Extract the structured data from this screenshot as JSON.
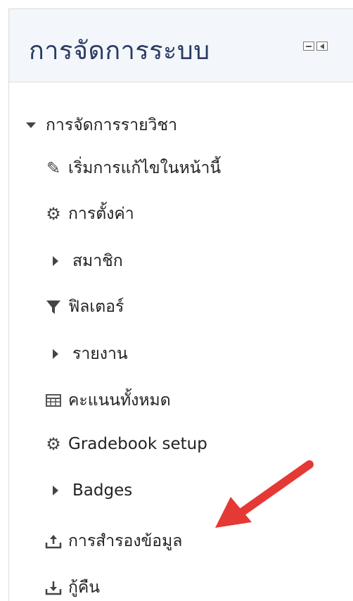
{
  "block": {
    "title": "การจัดการระบบ",
    "root": "การจัดการรายวิชา",
    "items": [
      {
        "label": "เริ่มการแก้ไขในหน้านี้",
        "icon": "pencil-icon"
      },
      {
        "label": "การตั้งค่า",
        "icon": "gear-icon"
      },
      {
        "label": "สมาชิก",
        "icon": "caret-right-icon"
      },
      {
        "label": "ฟิลเตอร์",
        "icon": "filter-icon"
      },
      {
        "label": "รายงาน",
        "icon": "caret-right-icon"
      },
      {
        "label": "คะแนนทั้งหมด",
        "icon": "table-icon"
      },
      {
        "label": "Gradebook setup",
        "icon": "gear-icon"
      },
      {
        "label": "Badges",
        "icon": "caret-right-icon"
      },
      {
        "label": "การสำรองข้อมูล",
        "icon": "upload-icon"
      },
      {
        "label": "กู้คืน",
        "icon": "download-icon"
      }
    ]
  },
  "colors": {
    "header_bg": "#f3f6fa",
    "title": "#2a3c62",
    "arrow": "#e53935"
  }
}
